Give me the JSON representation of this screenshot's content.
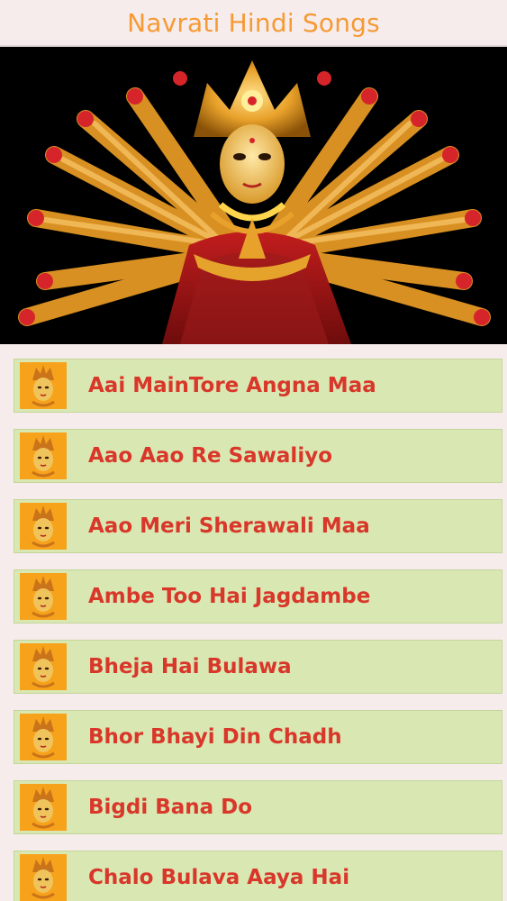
{
  "app": {
    "title": "Navrati Hindi Songs"
  },
  "hero": {
    "image": "goddess-durga-image"
  },
  "colors": {
    "title": "#f59a35",
    "item_background": "#d9e8b3",
    "item_text": "#d8372a",
    "page_background": "#f6ecec"
  },
  "songs": [
    {
      "title": "Aai MainTore Angna Maa",
      "icon": "goddess-face-icon"
    },
    {
      "title": "Aao Aao Re Sawaliyo",
      "icon": "goddess-face-icon"
    },
    {
      "title": "Aao Meri Sherawali Maa",
      "icon": "goddess-face-icon"
    },
    {
      "title": "Ambe Too Hai Jagdambe",
      "icon": "goddess-face-icon"
    },
    {
      "title": "Bheja Hai Bulawa",
      "icon": "goddess-face-icon"
    },
    {
      "title": "Bhor Bhayi Din Chadh",
      "icon": "goddess-face-icon"
    },
    {
      "title": "Bigdi Bana Do",
      "icon": "goddess-face-icon"
    },
    {
      "title": "Chalo Bulava Aaya Hai",
      "icon": "goddess-face-icon"
    }
  ]
}
